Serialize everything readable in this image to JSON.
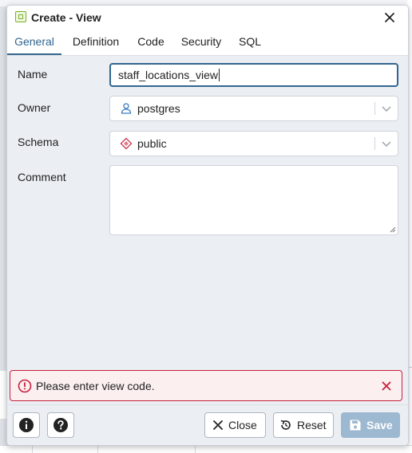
{
  "dialog": {
    "title": "Create - View",
    "close_label": "Close dialog"
  },
  "tabs": [
    {
      "label": "General",
      "active": true
    },
    {
      "label": "Definition",
      "active": false
    },
    {
      "label": "Code",
      "active": false
    },
    {
      "label": "Security",
      "active": false
    },
    {
      "label": "SQL",
      "active": false
    }
  ],
  "form": {
    "name": {
      "label": "Name",
      "value": "staff_locations_view"
    },
    "owner": {
      "label": "Owner",
      "value": "postgres",
      "icon": "user-icon"
    },
    "schema": {
      "label": "Schema",
      "value": "public",
      "icon": "schema-icon"
    },
    "comment": {
      "label": "Comment",
      "value": ""
    }
  },
  "error": {
    "message": "Please enter view code."
  },
  "footer": {
    "info_icon": "info-icon",
    "help_icon": "help-icon",
    "close_label": "Close",
    "reset_label": "Reset",
    "save_label": "Save"
  },
  "colors": {
    "accent": "#326690",
    "error": "#c6203b",
    "error_bg": "#fbeff0",
    "save_disabled": "#9db8d1",
    "view_icon": "#7ab026"
  }
}
